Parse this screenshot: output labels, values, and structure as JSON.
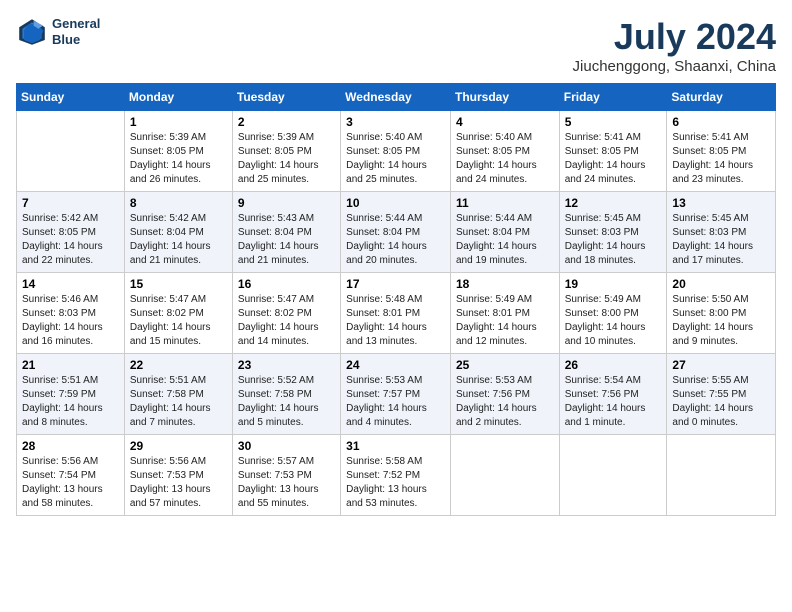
{
  "header": {
    "logo_line1": "General",
    "logo_line2": "Blue",
    "month": "July 2024",
    "location": "Jiuchenggong, Shaanxi, China"
  },
  "columns": [
    "Sunday",
    "Monday",
    "Tuesday",
    "Wednesday",
    "Thursday",
    "Friday",
    "Saturday"
  ],
  "weeks": [
    [
      {
        "day": "",
        "info": ""
      },
      {
        "day": "1",
        "info": "Sunrise: 5:39 AM\nSunset: 8:05 PM\nDaylight: 14 hours\nand 26 minutes."
      },
      {
        "day": "2",
        "info": "Sunrise: 5:39 AM\nSunset: 8:05 PM\nDaylight: 14 hours\nand 25 minutes."
      },
      {
        "day": "3",
        "info": "Sunrise: 5:40 AM\nSunset: 8:05 PM\nDaylight: 14 hours\nand 25 minutes."
      },
      {
        "day": "4",
        "info": "Sunrise: 5:40 AM\nSunset: 8:05 PM\nDaylight: 14 hours\nand 24 minutes."
      },
      {
        "day": "5",
        "info": "Sunrise: 5:41 AM\nSunset: 8:05 PM\nDaylight: 14 hours\nand 24 minutes."
      },
      {
        "day": "6",
        "info": "Sunrise: 5:41 AM\nSunset: 8:05 PM\nDaylight: 14 hours\nand 23 minutes."
      }
    ],
    [
      {
        "day": "7",
        "info": "Sunrise: 5:42 AM\nSunset: 8:05 PM\nDaylight: 14 hours\nand 22 minutes."
      },
      {
        "day": "8",
        "info": "Sunrise: 5:42 AM\nSunset: 8:04 PM\nDaylight: 14 hours\nand 21 minutes."
      },
      {
        "day": "9",
        "info": "Sunrise: 5:43 AM\nSunset: 8:04 PM\nDaylight: 14 hours\nand 21 minutes."
      },
      {
        "day": "10",
        "info": "Sunrise: 5:44 AM\nSunset: 8:04 PM\nDaylight: 14 hours\nand 20 minutes."
      },
      {
        "day": "11",
        "info": "Sunrise: 5:44 AM\nSunset: 8:04 PM\nDaylight: 14 hours\nand 19 minutes."
      },
      {
        "day": "12",
        "info": "Sunrise: 5:45 AM\nSunset: 8:03 PM\nDaylight: 14 hours\nand 18 minutes."
      },
      {
        "day": "13",
        "info": "Sunrise: 5:45 AM\nSunset: 8:03 PM\nDaylight: 14 hours\nand 17 minutes."
      }
    ],
    [
      {
        "day": "14",
        "info": "Sunrise: 5:46 AM\nSunset: 8:03 PM\nDaylight: 14 hours\nand 16 minutes."
      },
      {
        "day": "15",
        "info": "Sunrise: 5:47 AM\nSunset: 8:02 PM\nDaylight: 14 hours\nand 15 minutes."
      },
      {
        "day": "16",
        "info": "Sunrise: 5:47 AM\nSunset: 8:02 PM\nDaylight: 14 hours\nand 14 minutes."
      },
      {
        "day": "17",
        "info": "Sunrise: 5:48 AM\nSunset: 8:01 PM\nDaylight: 14 hours\nand 13 minutes."
      },
      {
        "day": "18",
        "info": "Sunrise: 5:49 AM\nSunset: 8:01 PM\nDaylight: 14 hours\nand 12 minutes."
      },
      {
        "day": "19",
        "info": "Sunrise: 5:49 AM\nSunset: 8:00 PM\nDaylight: 14 hours\nand 10 minutes."
      },
      {
        "day": "20",
        "info": "Sunrise: 5:50 AM\nSunset: 8:00 PM\nDaylight: 14 hours\nand 9 minutes."
      }
    ],
    [
      {
        "day": "21",
        "info": "Sunrise: 5:51 AM\nSunset: 7:59 PM\nDaylight: 14 hours\nand 8 minutes."
      },
      {
        "day": "22",
        "info": "Sunrise: 5:51 AM\nSunset: 7:58 PM\nDaylight: 14 hours\nand 7 minutes."
      },
      {
        "day": "23",
        "info": "Sunrise: 5:52 AM\nSunset: 7:58 PM\nDaylight: 14 hours\nand 5 minutes."
      },
      {
        "day": "24",
        "info": "Sunrise: 5:53 AM\nSunset: 7:57 PM\nDaylight: 14 hours\nand 4 minutes."
      },
      {
        "day": "25",
        "info": "Sunrise: 5:53 AM\nSunset: 7:56 PM\nDaylight: 14 hours\nand 2 minutes."
      },
      {
        "day": "26",
        "info": "Sunrise: 5:54 AM\nSunset: 7:56 PM\nDaylight: 14 hours\nand 1 minute."
      },
      {
        "day": "27",
        "info": "Sunrise: 5:55 AM\nSunset: 7:55 PM\nDaylight: 14 hours\nand 0 minutes."
      }
    ],
    [
      {
        "day": "28",
        "info": "Sunrise: 5:56 AM\nSunset: 7:54 PM\nDaylight: 13 hours\nand 58 minutes."
      },
      {
        "day": "29",
        "info": "Sunrise: 5:56 AM\nSunset: 7:53 PM\nDaylight: 13 hours\nand 57 minutes."
      },
      {
        "day": "30",
        "info": "Sunrise: 5:57 AM\nSunset: 7:53 PM\nDaylight: 13 hours\nand 55 minutes."
      },
      {
        "day": "31",
        "info": "Sunrise: 5:58 AM\nSunset: 7:52 PM\nDaylight: 13 hours\nand 53 minutes."
      },
      {
        "day": "",
        "info": ""
      },
      {
        "day": "",
        "info": ""
      },
      {
        "day": "",
        "info": ""
      }
    ]
  ]
}
